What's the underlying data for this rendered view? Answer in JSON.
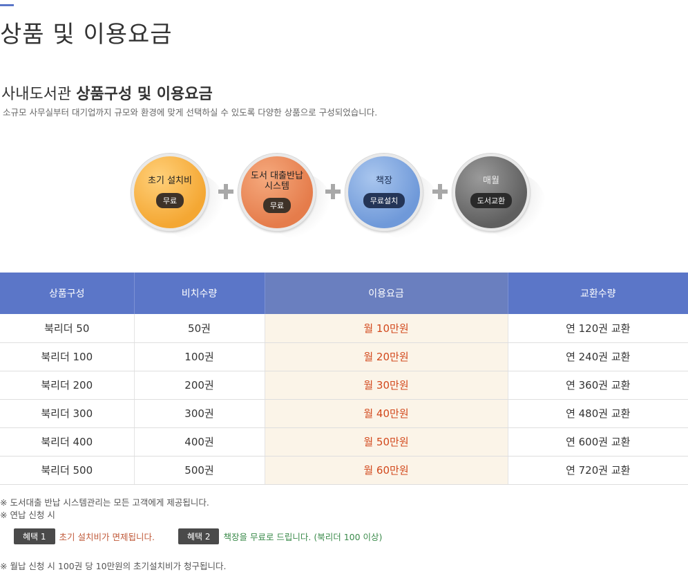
{
  "page": {
    "title": "상품 및 이용요금"
  },
  "section": {
    "title_light": "사내도서관",
    "title_bold": "상품구성 및 이용요금",
    "description": "소규모 사무실부터 대기업까지 규모와 환경에 맞게 선택하실 수 있도록 다양한 상품으로 구성되었습니다."
  },
  "circles": [
    {
      "label": "초기 설치비",
      "badge": "무료",
      "color": "#f4a733"
    },
    {
      "label": "도서 대출반납\n시스템",
      "badge": "무료",
      "color": "#e57c4b"
    },
    {
      "label": "책장",
      "badge": "무료설치",
      "color": "#6f99d9"
    },
    {
      "label": "매월",
      "badge": "도서교환",
      "color": "#5f5f5f"
    }
  ],
  "table": {
    "headers": [
      "상품구성",
      "비치수량",
      "이용요금",
      "교환수량"
    ],
    "rows": [
      {
        "product": "북리더 50",
        "quantity": "50권",
        "fee": "월 10만원",
        "exchange": "연 120권 교환"
      },
      {
        "product": "북리더 100",
        "quantity": "100권",
        "fee": "월 20만원",
        "exchange": "연 240권 교환"
      },
      {
        "product": "북리더 200",
        "quantity": "200권",
        "fee": "월 30만원",
        "exchange": "연 360권 교환"
      },
      {
        "product": "북리더 300",
        "quantity": "300권",
        "fee": "월 40만원",
        "exchange": "연 480권 교환"
      },
      {
        "product": "북리더 400",
        "quantity": "400권",
        "fee": "월 50만원",
        "exchange": "연 600권 교환"
      },
      {
        "product": "북리더 500",
        "quantity": "500권",
        "fee": "월 60만원",
        "exchange": "연 720권 교환"
      }
    ]
  },
  "notes": {
    "note1": "※  도서대출 반납 시스템관리는 모든 고객에게 제공됩니다.",
    "note2": "※  연납 신청 시",
    "benefit1_badge": "혜택 1",
    "benefit1_text": "초기 설치비가 면제됩니다.",
    "benefit2_badge": "혜택 2",
    "benefit2_text": "책장을 무료로 드립니다. (북리더 100 이상)",
    "footnote": "※ 월납 신청 시 100권 당 10만원의 초기설치비가 청구됩니다."
  },
  "colors": {
    "accent": "#5b76c8",
    "fee_text": "#d2481c",
    "benefit1": "#c05a3a",
    "benefit2": "#3a8a4a"
  }
}
